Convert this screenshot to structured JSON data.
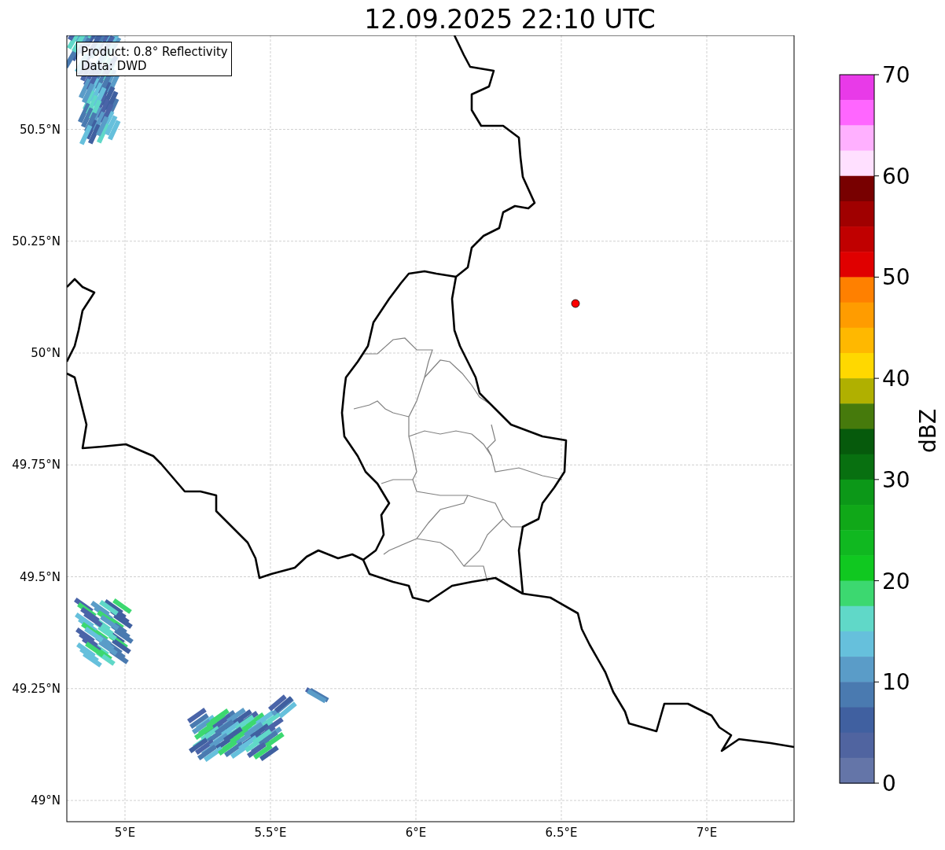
{
  "title": "12.09.2025 22:10 UTC",
  "info_box": [
    "Product: 0.8° Reflectivity",
    "Data: DWD"
  ],
  "x_ticks": [
    "5°E",
    "5.5°E",
    "6°E",
    "6.5°E",
    "7°E"
  ],
  "y_ticks": [
    "50.5°N",
    "50.25°N",
    "50°N",
    "49.75°N",
    "49.5°N",
    "49.25°N",
    "49°N"
  ],
  "colorbar": {
    "label": "dBZ",
    "ticks": [
      "70",
      "60",
      "50",
      "40",
      "30",
      "20",
      "10",
      "0"
    ],
    "bins": [
      {
        "color": "#e83ae8"
      },
      {
        "color": "#ff66ff"
      },
      {
        "color": "#ffb0ff"
      },
      {
        "color": "#ffe0ff"
      },
      {
        "color": "#780000"
      },
      {
        "color": "#a00000"
      },
      {
        "color": "#c00000"
      },
      {
        "color": "#e00000"
      },
      {
        "color": "#ff8000"
      },
      {
        "color": "#ff9c00"
      },
      {
        "color": "#ffb800"
      },
      {
        "color": "#ffd800"
      },
      {
        "color": "#b0b000"
      },
      {
        "color": "#467a0c"
      },
      {
        "color": "#065a0c"
      },
      {
        "color": "#087010"
      },
      {
        "color": "#0c9818"
      },
      {
        "color": "#10a818"
      },
      {
        "color": "#10b820"
      },
      {
        "color": "#10c820"
      },
      {
        "color": "#3cd870"
      },
      {
        "color": "#60d8c8"
      },
      {
        "color": "#66c0dc"
      },
      {
        "color": "#5a9cc8"
      },
      {
        "color": "#4a7ab0"
      },
      {
        "color": "#4060a0"
      },
      {
        "color": "#5064a0"
      },
      {
        "color": "#6475a8"
      }
    ]
  }
}
